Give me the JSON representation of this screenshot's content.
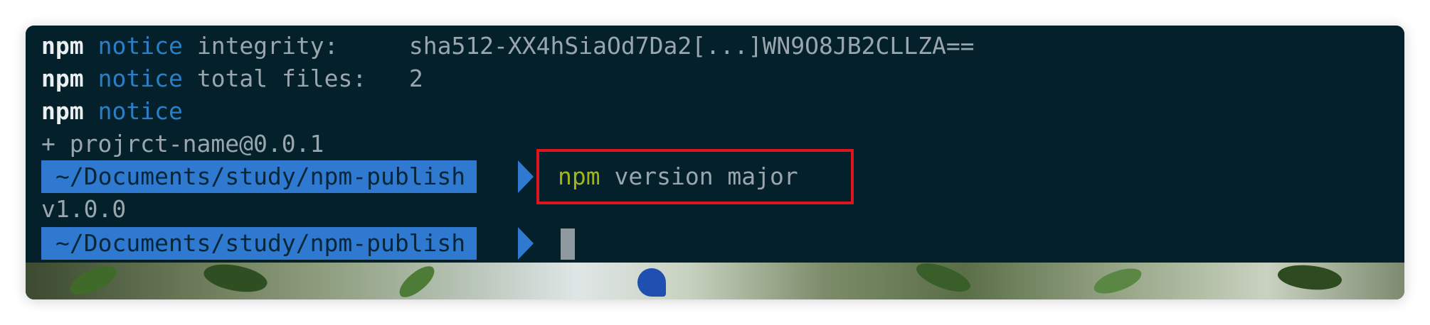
{
  "terminal": {
    "lines": [
      {
        "prefix": "npm",
        "tag": "notice",
        "key": "integrity:     ",
        "value": "sha512-XX4hSiaOd7Da2[...]WN9O8JB2CLLZA=="
      },
      {
        "prefix": "npm",
        "tag": "notice",
        "key": "total files:   ",
        "value": "2"
      },
      {
        "prefix": "npm",
        "tag": "notice",
        "key": "",
        "value": ""
      }
    ],
    "publish_result": "+ projrct-name@0.0.1",
    "prompt_1": {
      "path": "~/Documents/study/npm-publish",
      "command_program": "npm",
      "command_args": "version major"
    },
    "version_output": "v1.0.0",
    "prompt_2": {
      "path": "~/Documents/study/npm-publish"
    }
  },
  "colors": {
    "background": "#04202a",
    "prompt_segment": "#2f7ad0",
    "highlight_border": "#e0141c",
    "notice": "#2a7fc9",
    "command": "#a3b418"
  }
}
